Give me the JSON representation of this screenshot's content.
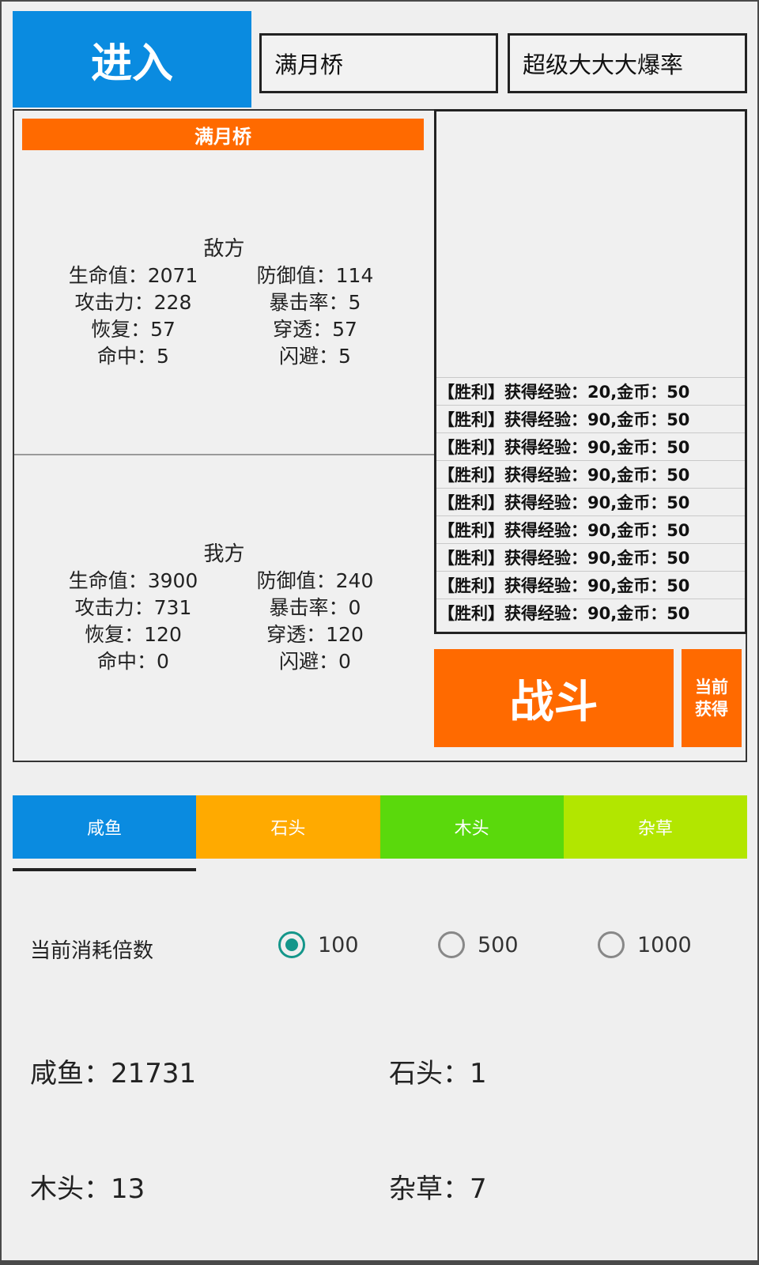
{
  "top": {
    "enter_label": "进入",
    "map_field_value": "满月桥",
    "mode_field_value": "超级大大大爆率"
  },
  "battle": {
    "map_title": "满月桥",
    "enemy": {
      "title": "敌方",
      "hp": "生命值：2071",
      "defense": "防御值：114",
      "attack": "攻击力：228",
      "crit": "暴击率：5",
      "recovery": "恢复：57",
      "penetration": "穿透：57",
      "hit": "命中：5",
      "dodge": "闪避：5"
    },
    "ally": {
      "title": "我方",
      "hp": "生命值：3900",
      "defense": "防御值：240",
      "attack": "攻击力：731",
      "crit": "暴击率：0",
      "recovery": "恢复：120",
      "penetration": "穿透：120",
      "hit": "命中：0",
      "dodge": "闪避：0"
    },
    "log": [
      "【胜利】获得经验：20,金币：50",
      "【胜利】获得经验：90,金币：50",
      "【胜利】获得经验：90,金币：50",
      "【胜利】获得经验：90,金币：50",
      "【胜利】获得经验：90,金币：50",
      "【胜利】获得经验：90,金币：50",
      "【胜利】获得经验：90,金币：50",
      "【胜利】获得经验：90,金币：50",
      "【胜利】获得经验：90,金币：50"
    ],
    "fight_label": "战斗",
    "current_gain_label": "当前获得"
  },
  "tabs": [
    {
      "label": "咸鱼",
      "color": "#0a8be0"
    },
    {
      "label": "石头",
      "color": "#ffaa00"
    },
    {
      "label": "木头",
      "color": "#5ad90c"
    },
    {
      "label": "杂草",
      "color": "#b2e600"
    }
  ],
  "multiplier": {
    "label": "当前消耗倍数",
    "options": [
      "100",
      "500",
      "1000"
    ],
    "selected": "100"
  },
  "resources": {
    "fish": "咸鱼：21731",
    "stone": "石头：1",
    "wood": "木头：13",
    "grass": "杂草：7"
  },
  "colors": {
    "primary_blue": "#0a8be0",
    "orange": "#ff6a00",
    "radio_teal": "#14968a"
  }
}
